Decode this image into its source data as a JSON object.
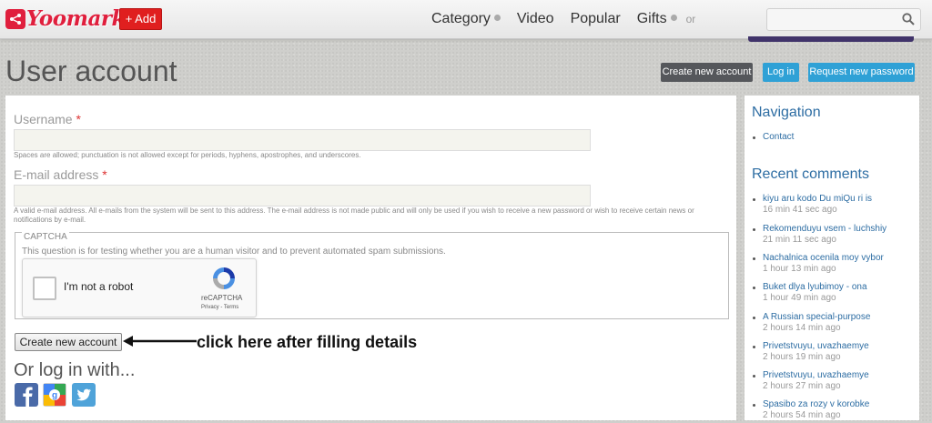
{
  "header": {
    "logo_text": "Yoomark",
    "add_label": "+ Add",
    "nav": [
      {
        "label": "Category",
        "dropdown": true
      },
      {
        "label": "Video",
        "dropdown": false
      },
      {
        "label": "Popular",
        "dropdown": false
      },
      {
        "label": "Gifts",
        "dropdown": true
      }
    ],
    "nav_or": "or",
    "search_placeholder": ""
  },
  "page": {
    "title": "User account",
    "actions": {
      "create": "Create new account",
      "login": "Log in",
      "reset": "Request new password"
    }
  },
  "form": {
    "username_label": "Username",
    "username_desc": "Spaces are allowed; punctuation is not allowed except for periods, hyphens, apostrophes, and underscores.",
    "email_label": "E-mail address",
    "email_desc": "A valid e-mail address. All e-mails from the system will be sent to this address. The e-mail address is not made public and will only be used if you wish to receive a new password or wish to receive certain news or notifications by e-mail.",
    "required_mark": "*",
    "captcha_legend": "CAPTCHA",
    "captcha_desc": "This question is for testing whether you are a human visitor and to prevent automated spam submissions.",
    "recaptcha_text": "I'm not a robot",
    "recaptcha_brand": "reCAPTCHA",
    "recaptcha_links": "Privacy - Terms",
    "submit_label": "Create new account",
    "annotation": "click here after filling details",
    "or_login": "Or log in with..."
  },
  "sidebar": {
    "nav_title": "Navigation",
    "nav_links": [
      "Contact"
    ],
    "recent_title": "Recent comments",
    "comments": [
      {
        "title": "kiyu aru kodo Du miQu ri is",
        "time": "16 min 41 sec ago"
      },
      {
        "title": "Rekomenduyu vsem - luchshiy",
        "time": "21 min 11 sec ago"
      },
      {
        "title": "Nachalnica ocenila moy vybor",
        "time": "1 hour 13 min ago"
      },
      {
        "title": "Buket dlya lyubimoy - ona",
        "time": "1 hour 49 min ago"
      },
      {
        "title": "A Russian special-purpose",
        "time": "2 hours 14 min ago"
      },
      {
        "title": "Privetstvuyu, uvazhaemye",
        "time": "2 hours 19 min ago"
      },
      {
        "title": "Privetstvuyu, uvazhaemye",
        "time": "2 hours 27 min ago"
      },
      {
        "title": "Spasibo za rozy v korobke",
        "time": "2 hours 54 min ago"
      }
    ]
  },
  "colors": {
    "brand": "#e01f3d",
    "link": "#2d6da3",
    "accent_blue": "#2fa1d6"
  }
}
